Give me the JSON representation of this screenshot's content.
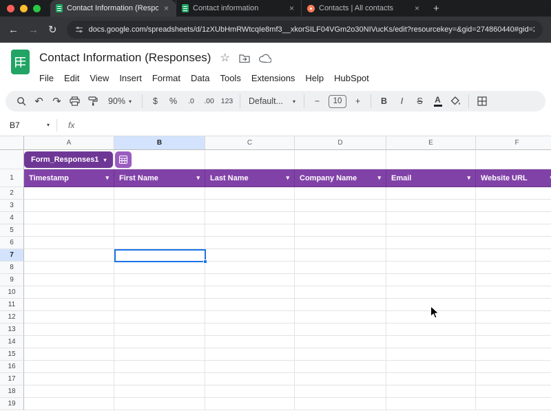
{
  "icons": {
    "chevron_down": "▾"
  },
  "browser": {
    "window_controls": [
      "close",
      "minimize",
      "zoom"
    ],
    "tabs": [
      {
        "label": "Contact Information (Respon",
        "icon": "sheets",
        "active": true
      },
      {
        "label": "Contact information",
        "icon": "sheets",
        "active": false
      },
      {
        "label": "Contacts | All contacts",
        "icon": "hubspot",
        "active": false
      }
    ],
    "new_tab_label": "+",
    "nav": {
      "back": "←",
      "forward": "→",
      "reload": "↻"
    },
    "url": "docs.google.com/spreadsheets/d/1zXUbHmRWtcqIe8mf3__xkorSILF04VGm2o30NIVucKs/edit?resourcekey=&gid=274860440#gid=27"
  },
  "header": {
    "title": "Contact Information (Responses)",
    "star": "☆",
    "menus": [
      "File",
      "Edit",
      "View",
      "Insert",
      "Format",
      "Data",
      "Tools",
      "Extensions",
      "Help",
      "HubSpot"
    ]
  },
  "toolbar": {
    "undo": "↶",
    "redo": "↷",
    "zoom": "90%",
    "currency": "$",
    "percent": "%",
    "decrease_decimal": ".0",
    "increase_decimal": ".00",
    "more_formats": "123",
    "font": "Default...",
    "font_size_decrease": "−",
    "font_size": "10",
    "font_size_increase": "+",
    "bold": "B",
    "italic": "I",
    "strikethrough": "S",
    "text_color": "A"
  },
  "formula_bar": {
    "cell_ref": "B7",
    "fx": "fx"
  },
  "sheet": {
    "columns": [
      "A",
      "B",
      "C",
      "D",
      "E",
      "F"
    ],
    "first_row": 1,
    "last_row": 19,
    "selected_cell": "B7",
    "selected_column": "B",
    "selected_row": 7,
    "table_chip": {
      "name": "Form_Responses1"
    },
    "table_header": [
      "Timestamp",
      "First Name",
      "Last Name",
      "Company Name",
      "Email",
      "Website URL"
    ]
  },
  "colors": {
    "table_header_purple": "#8142a8",
    "chip_purple": "#6f3795",
    "chip_button_purple": "#9a5cc0",
    "selection_blue": "#1a73e8",
    "selected_header_bg": "#d3e3fd",
    "sheets_green": "#1ea362",
    "hubspot_orange": "#ff7a59"
  }
}
